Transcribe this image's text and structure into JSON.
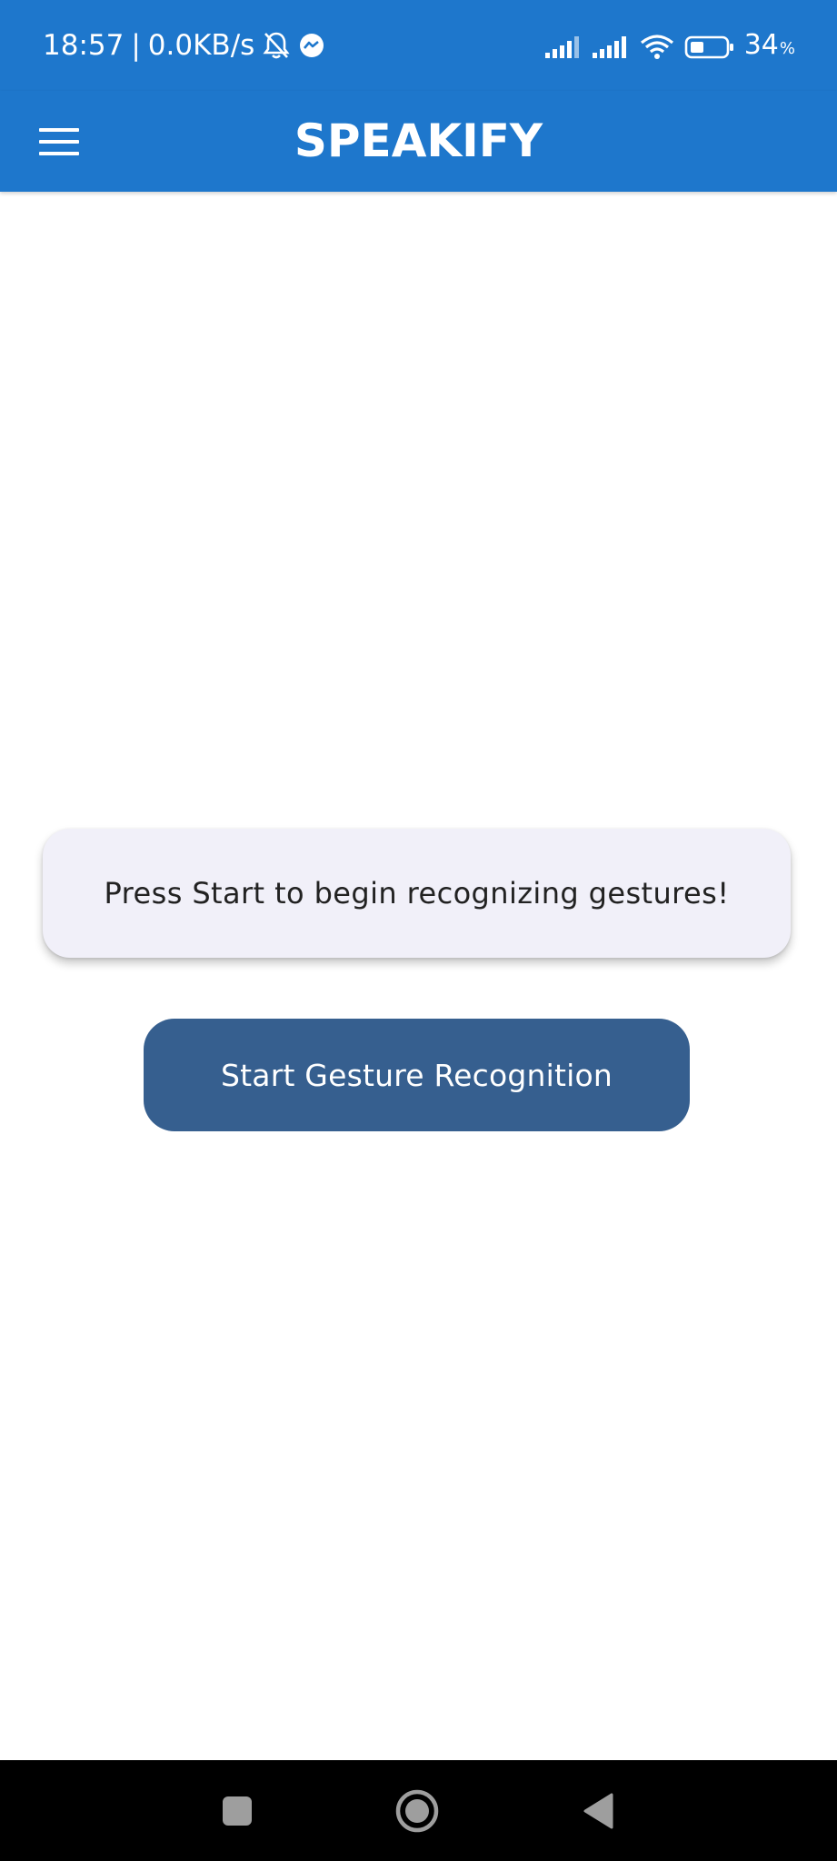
{
  "status_bar": {
    "time": "18:57",
    "separator": "|",
    "net_speed": "0.0KB/s",
    "battery_level": "34",
    "battery_unit": "%",
    "icons": [
      "bell-off-icon",
      "messenger-icon",
      "signal-icon",
      "signal-icon",
      "wifi-icon",
      "battery-icon"
    ]
  },
  "app_bar": {
    "title": "SPEAKIFY",
    "menu_icon": "hamburger-menu-icon"
  },
  "main": {
    "message": "Press Start to begin recognizing gestures!",
    "start_button_label": "Start Gesture Recognition"
  },
  "nav_bar": {
    "icons": [
      "recents-square-icon",
      "home-circle-icon",
      "back-triangle-icon"
    ]
  },
  "colors": {
    "primary": "#1e77cc",
    "button": "#365f8f",
    "card": "#f1f0f9",
    "nav_bar": "#000000"
  }
}
